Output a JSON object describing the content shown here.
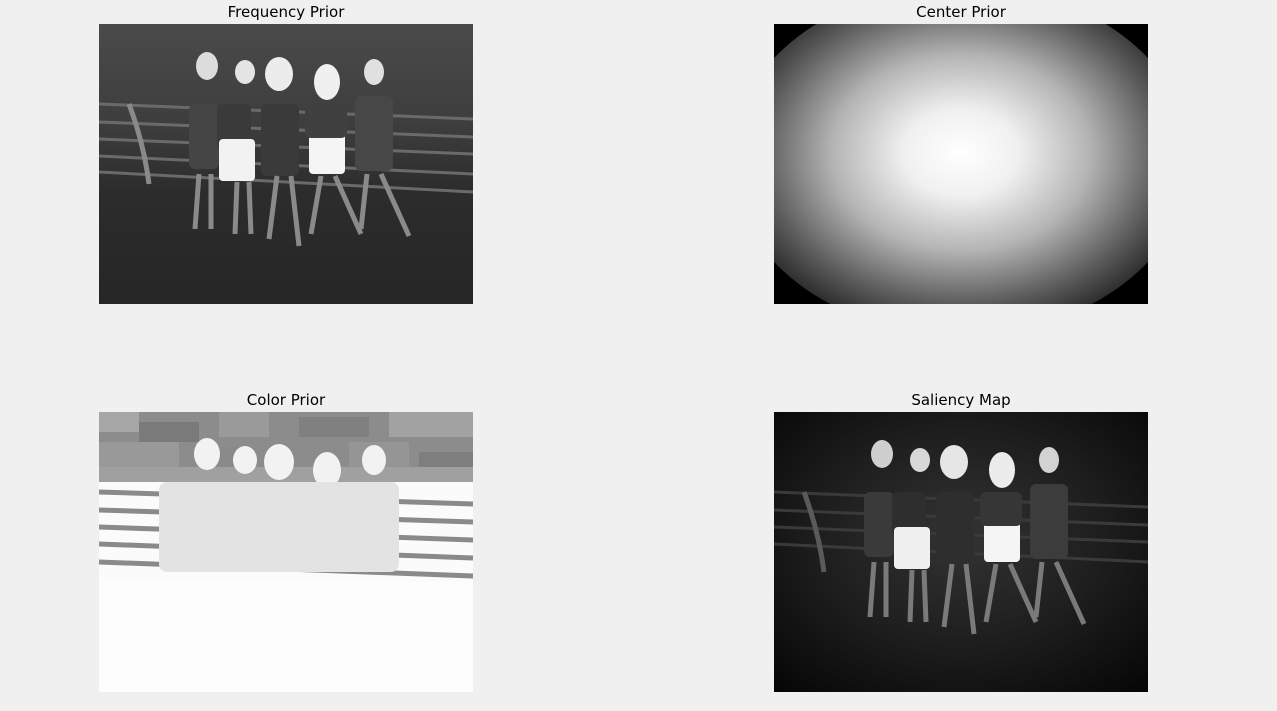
{
  "window": {
    "background": "#f0f0f0"
  },
  "panels": [
    {
      "title": "Frequency Prior",
      "image": "grayscale frequency prior map of five girls on a boardwalk"
    },
    {
      "title": "Center Prior",
      "image": "radial gaussian center prior"
    },
    {
      "title": "Color Prior",
      "image": "bright color prior map"
    },
    {
      "title": "Saliency Map",
      "image": "final saliency map"
    }
  ]
}
